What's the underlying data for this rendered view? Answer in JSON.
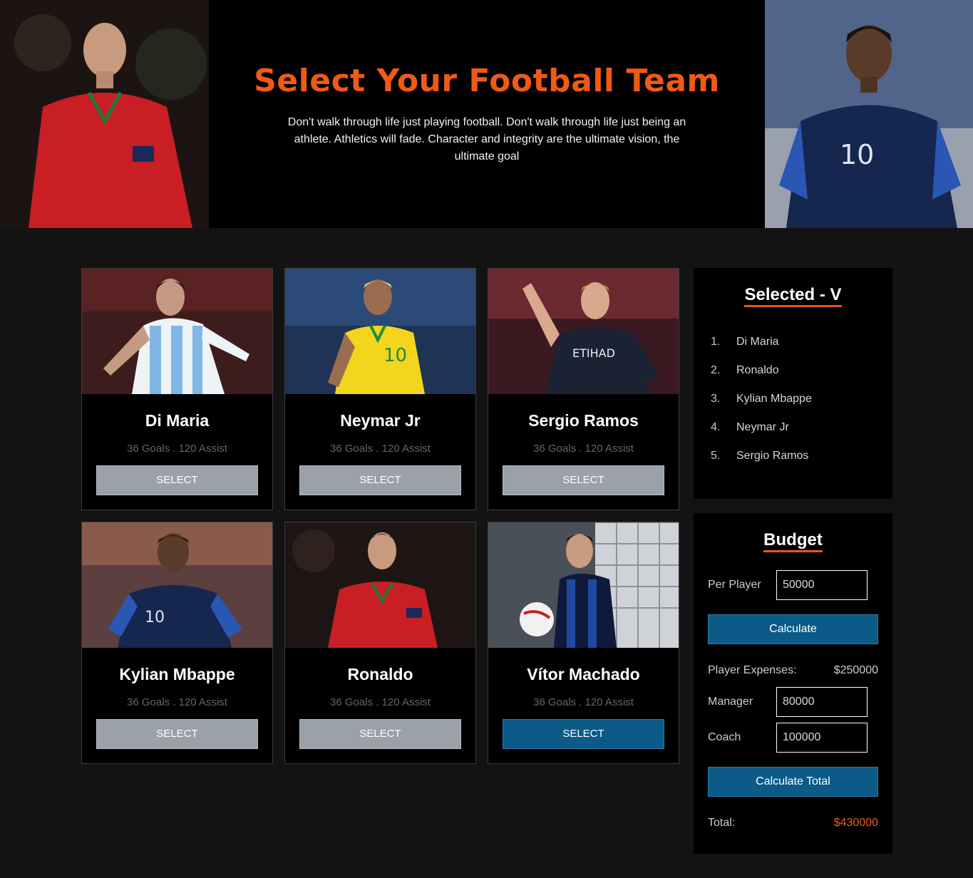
{
  "header": {
    "title": "Select Your Football Team",
    "subtitle": "Don't walk through life just playing football. Don't walk through life just being an athlete. Athletics will fade. Character and integrity are the ultimate vision, the ultimate goal"
  },
  "players": [
    {
      "name": "Di Maria",
      "stats": "36 Goals . 120 Assist",
      "button": "SELECT",
      "selected_state": false
    },
    {
      "name": "Neymar Jr",
      "stats": "36 Goals . 120 Assist",
      "button": "SELECT",
      "selected_state": false
    },
    {
      "name": "Sergio Ramos",
      "stats": "36 Goals . 120 Assist",
      "button": "SELECT",
      "selected_state": false
    },
    {
      "name": "Kylian Mbappe",
      "stats": "36 Goals . 120 Assist",
      "button": "SELECT",
      "selected_state": false
    },
    {
      "name": "Ronaldo",
      "stats": "36 Goals . 120 Assist",
      "button": "SELECT",
      "selected_state": false
    },
    {
      "name": "Vítor Machado",
      "stats": "36 Goals . 120 Assist",
      "button": "SELECT",
      "selected_state": true
    }
  ],
  "selected_panel": {
    "title": "Selected - V",
    "items": [
      {
        "num": "1.",
        "name": "Di Maria"
      },
      {
        "num": "2.",
        "name": "Ronaldo"
      },
      {
        "num": "3.",
        "name": "Kylian Mbappe"
      },
      {
        "num": "4.",
        "name": "Neymar Jr"
      },
      {
        "num": "5.",
        "name": "Sergio Ramos"
      }
    ]
  },
  "budget": {
    "title": "Budget",
    "per_player_label": "Per Player",
    "per_player_value": "50000",
    "calculate_label": "Calculate",
    "player_expenses_label": "Player Expenses:",
    "player_expenses_value": "$250000",
    "manager_label": "Manager",
    "manager_value": "80000",
    "coach_label": "Coach",
    "coach_value": "100000",
    "calculate_total_label": "Calculate Total",
    "total_label": "Total:",
    "total_value": "$430000"
  },
  "colors": {
    "accent": "#f05a14",
    "button_active": "#0b5a87",
    "button_inactive": "#9aa1a8",
    "background": "#131313"
  }
}
